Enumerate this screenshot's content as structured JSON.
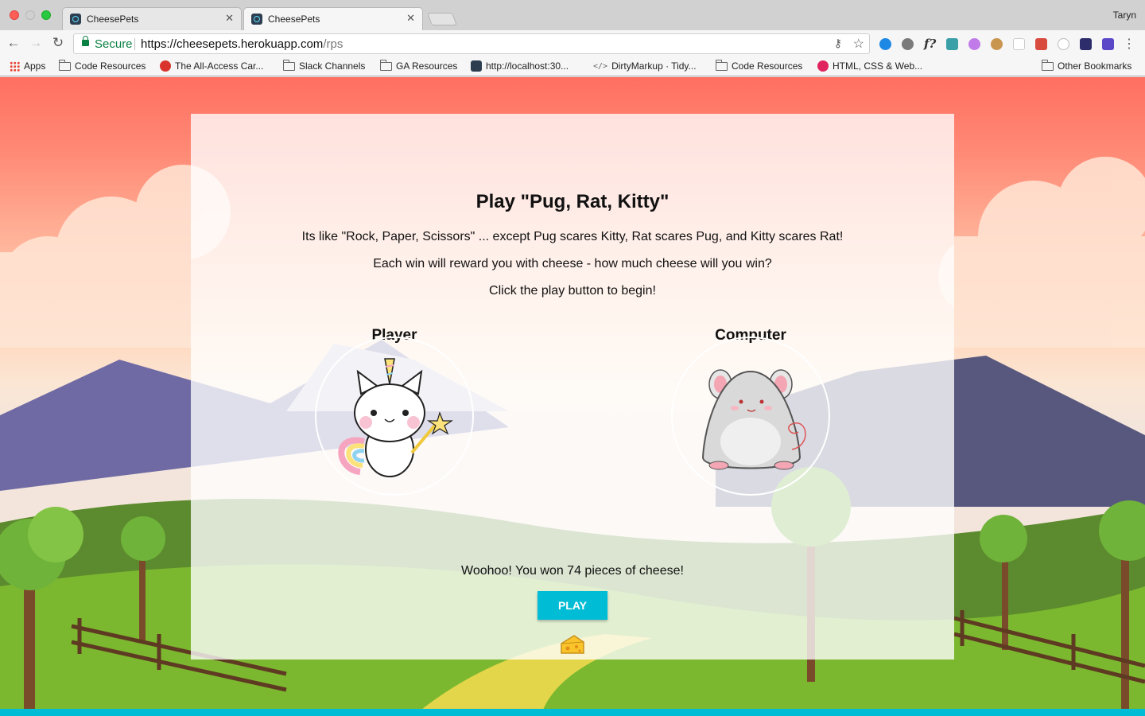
{
  "browser": {
    "tabs": [
      {
        "title": "CheesePets",
        "active": false
      },
      {
        "title": "CheesePets",
        "active": true
      }
    ],
    "profile": "Taryn",
    "address": {
      "secure_label": "Secure",
      "url_host": "https://cheesepets.herokuapp.com",
      "url_path": "/rps"
    },
    "bookmarks": [
      {
        "label": "Apps",
        "icon": "apps-grid-icon"
      },
      {
        "label": "Code Resources",
        "icon": "folder-icon"
      },
      {
        "label": "The All-Access Car...",
        "icon": "red-circle-icon"
      },
      {
        "label": "Slack Channels",
        "icon": "folder-icon"
      },
      {
        "label": "GA Resources",
        "icon": "folder-icon"
      },
      {
        "label": "http://localhost:30...",
        "icon": "react-icon"
      },
      {
        "label": "DirtyMarkup · Tidy...",
        "icon": "code-icon"
      },
      {
        "label": "Code Resources",
        "icon": "folder-icon"
      },
      {
        "label": "HTML, CSS & Web...",
        "icon": "red-gear-icon"
      },
      {
        "label": "Other Bookmarks",
        "icon": "folder-icon"
      }
    ]
  },
  "game": {
    "title": "Play \"Pug, Rat, Kitty\"",
    "intro": "Its like \"Rock, Paper, Scissors\" ... except Pug scares Kitty, Rat scares Pug, and Kitty scares Rat!",
    "reward": "Each win will reward you with cheese - how much cheese will you win?",
    "begin": "Click the play button to begin!",
    "player_label": "Player",
    "computer_label": "Computer",
    "player_choice": "unicorn-kitty-image",
    "computer_choice": "rat-image",
    "result": "Woohoo! You won 74 pieces of cheese!",
    "play_button": "PLAY",
    "cheese_icon": "cheese-icon"
  },
  "colors": {
    "accent": "#00bcd4",
    "secure": "#0b8043",
    "sky_top": "#ff6f61"
  }
}
